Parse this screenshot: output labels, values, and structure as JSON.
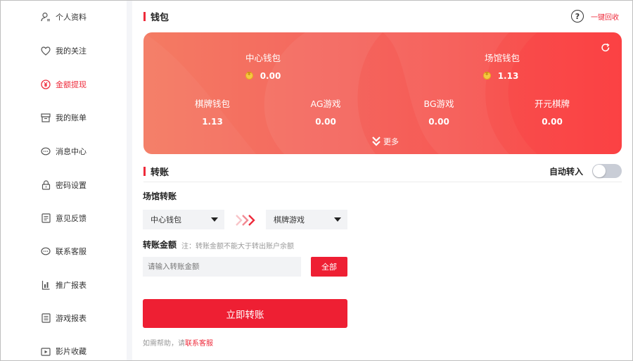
{
  "sidebar": {
    "items": [
      {
        "label": "个人资料",
        "icon": "user-icon",
        "active": false
      },
      {
        "label": "我的关注",
        "icon": "heart-icon",
        "active": false
      },
      {
        "label": "金额提现",
        "icon": "yen-icon",
        "active": true
      },
      {
        "label": "我的账单",
        "icon": "box-icon",
        "active": false
      },
      {
        "label": "消息中心",
        "icon": "message-icon",
        "active": false
      },
      {
        "label": "密码设置",
        "icon": "lock-icon",
        "active": false
      },
      {
        "label": "意见反馈",
        "icon": "feedback-icon",
        "active": false
      },
      {
        "label": "联系客服",
        "icon": "chat-icon",
        "active": false
      },
      {
        "label": "推广报表",
        "icon": "report-icon",
        "active": false
      },
      {
        "label": "游戏报表",
        "icon": "game-report-icon",
        "active": false
      },
      {
        "label": "影片收藏",
        "icon": "video-icon",
        "active": false
      }
    ]
  },
  "wallet": {
    "title": "钱包",
    "recover_label": "一键回收",
    "help_glyph": "?",
    "center": {
      "label": "中心钱包",
      "value": "0.00"
    },
    "venue": {
      "label": "场馆钱包",
      "value": "1.13"
    },
    "games": [
      {
        "label": "棋牌钱包",
        "value": "1.13"
      },
      {
        "label": "AG游戏",
        "value": "0.00"
      },
      {
        "label": "BG游戏",
        "value": "0.00"
      },
      {
        "label": "开元棋牌",
        "value": "0.00"
      }
    ],
    "more_label": "更多"
  },
  "transfer": {
    "title": "转账",
    "auto_label": "自动转入",
    "auto_enabled": false,
    "venue_transfer_label": "场馆转账",
    "from_select": "中心钱包",
    "to_select": "棋牌游戏",
    "amount_label": "转账金额",
    "amount_note": "注：转账金额不能大于转出账户余额",
    "amount_placeholder": "请输入转账金额",
    "all_button": "全部",
    "submit_button": "立即转账",
    "help_prefix": "如需帮助，请",
    "help_link": "联系客服"
  },
  "colors": {
    "accent": "#ee1f33",
    "card_start": "#f47b63",
    "card_end": "#fa4646"
  }
}
